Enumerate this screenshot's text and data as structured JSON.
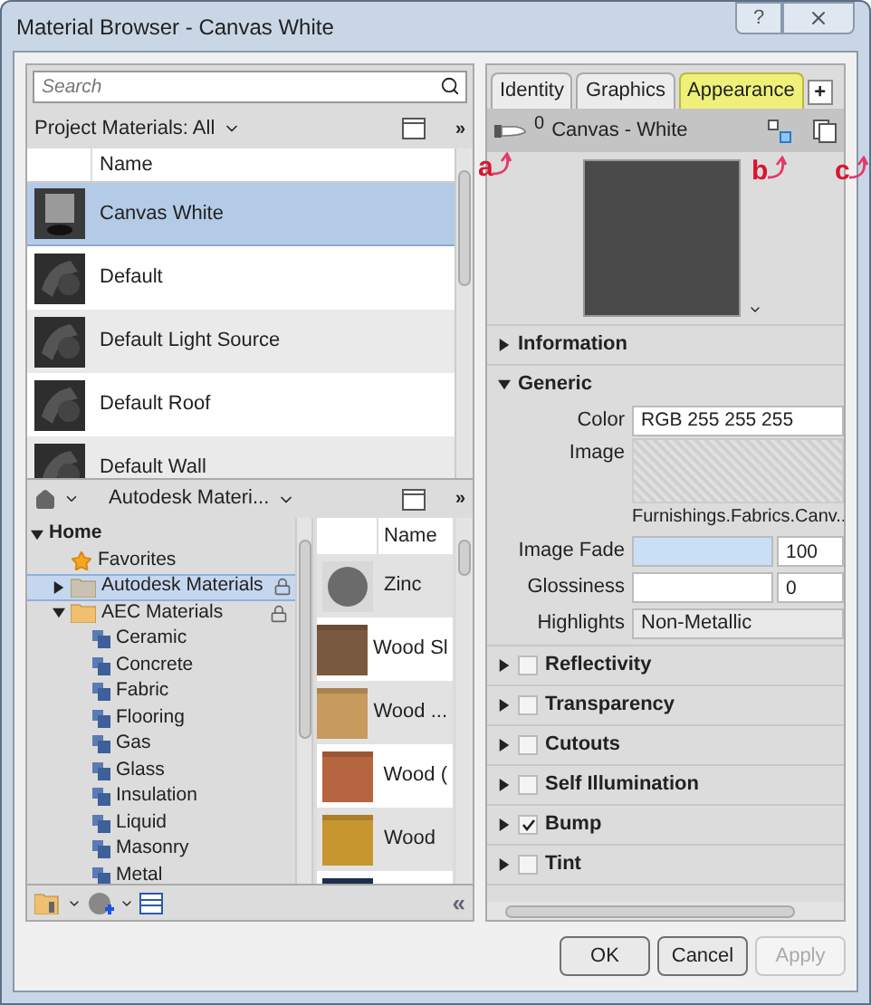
{
  "window": {
    "title": "Material Browser - Canvas White",
    "help": "?"
  },
  "project": {
    "search_placeholder": "Search",
    "filter": "Project Materials: All",
    "more": "»",
    "columns": [
      "Name"
    ],
    "rows": [
      {
        "name": "Canvas White",
        "kind": "canvas",
        "selected": true
      },
      {
        "name": "Default",
        "kind": "default",
        "selected": false
      },
      {
        "name": "Default Light Source",
        "kind": "default",
        "selected": false
      },
      {
        "name": "Default Roof",
        "kind": "default",
        "selected": false
      },
      {
        "name": "Default Wall",
        "kind": "default",
        "selected": false
      }
    ]
  },
  "library": {
    "breadcrumb": "Autodesk Materi...",
    "more": "»",
    "collapse": "«",
    "tree": [
      {
        "label": "Home",
        "kind": "root",
        "expanded": true,
        "selected": false,
        "locked": false,
        "children": [
          {
            "label": "Favorites",
            "kind": "star",
            "selected": false,
            "locked": false
          },
          {
            "label": "Autodesk Materials",
            "kind": "folder",
            "expanded": false,
            "selected": true,
            "locked": true
          },
          {
            "label": "AEC Materials",
            "kind": "folder",
            "expanded": true,
            "selected": false,
            "locked": true,
            "children": [
              {
                "label": "Ceramic",
                "kind": "category",
                "selected": false,
                "locked": false
              },
              {
                "label": "Concrete",
                "kind": "category",
                "selected": false,
                "locked": false
              },
              {
                "label": "Fabric",
                "kind": "category",
                "selected": false,
                "locked": false
              },
              {
                "label": "Flooring",
                "kind": "category",
                "selected": false,
                "locked": false
              },
              {
                "label": "Gas",
                "kind": "category",
                "selected": false,
                "locked": false
              },
              {
                "label": "Glass",
                "kind": "category",
                "selected": false,
                "locked": false
              },
              {
                "label": "Insulation",
                "kind": "category",
                "selected": false,
                "locked": false
              },
              {
                "label": "Liquid",
                "kind": "category",
                "selected": false,
                "locked": false
              },
              {
                "label": "Masonry",
                "kind": "category",
                "selected": false,
                "locked": false
              },
              {
                "label": "Metal",
                "kind": "category",
                "selected": false,
                "locked": false
              }
            ]
          }
        ]
      }
    ],
    "columns": [
      "Name"
    ],
    "items": [
      {
        "name": "Zinc",
        "kind": "sphere",
        "color": "#6b6b6b"
      },
      {
        "name": "Wood Sl",
        "kind": "cube",
        "color": "#7a5a40"
      },
      {
        "name": "Wood ...",
        "kind": "cube",
        "color": "#c79a5e"
      },
      {
        "name": "Wood (",
        "kind": "cube",
        "color": "#b5653f"
      },
      {
        "name": "Wood",
        "kind": "cube",
        "color": "#c8962e"
      },
      {
        "kind": "cube",
        "color": "#24385a"
      }
    ]
  },
  "editor": {
    "tabs": [
      {
        "label": "Identity",
        "selected": false
      },
      {
        "label": "Graphics",
        "selected": false
      },
      {
        "label": "Appearance",
        "selected": true
      }
    ],
    "add_tab": "+",
    "usage_count": "0",
    "asset_name": "Canvas - White",
    "annotations": [
      {
        "label": "a"
      },
      {
        "label": "b"
      },
      {
        "label": "c"
      }
    ],
    "sections": [
      {
        "title": "Information",
        "kind": "plain",
        "expanded": false
      },
      {
        "title": "Generic",
        "kind": "plain",
        "expanded": true,
        "properties": [
          {
            "label": "Color",
            "kind": "text",
            "value": "RGB 255 255 255"
          },
          {
            "label": "Image",
            "kind": "image",
            "caption": "Furnishings.Fabrics.Canv.."
          },
          {
            "label": "Image Fade",
            "kind": "slider",
            "level": 1,
            "value": "100"
          },
          {
            "label": "Glossiness",
            "kind": "slider",
            "level": 0,
            "value": "0"
          },
          {
            "label": "Highlights",
            "kind": "select",
            "value": "Non-Metallic"
          }
        ]
      },
      {
        "title": "Reflectivity",
        "kind": "checkable",
        "expanded": false,
        "checked": false
      },
      {
        "title": "Transparency",
        "kind": "checkable",
        "expanded": false,
        "checked": false
      },
      {
        "title": "Cutouts",
        "kind": "checkable",
        "expanded": false,
        "checked": false
      },
      {
        "title": "Self Illumination",
        "kind": "checkable",
        "expanded": false,
        "checked": false
      },
      {
        "title": "Bump",
        "kind": "checkable",
        "expanded": false,
        "checked": true
      },
      {
        "title": "Tint",
        "kind": "checkable",
        "expanded": false,
        "checked": false
      }
    ]
  },
  "buttons": [
    {
      "label": "OK",
      "disabled": false
    },
    {
      "label": "Cancel",
      "disabled": false
    },
    {
      "label": "Apply",
      "disabled": true
    }
  ]
}
